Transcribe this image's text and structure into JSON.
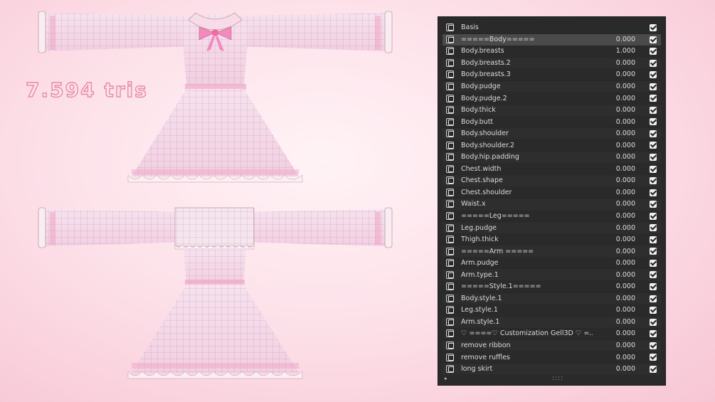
{
  "overlay_label": "7.594 tris",
  "shape_keys": [
    {
      "name": "Basis",
      "value": "",
      "enabled": true
    },
    {
      "name": "=====Body=====",
      "value": "0.000",
      "enabled": true
    },
    {
      "name": "Body.breasts",
      "value": "1.000",
      "enabled": true
    },
    {
      "name": "Body.breasts.2",
      "value": "0.000",
      "enabled": true
    },
    {
      "name": "Body.breasts.3",
      "value": "0.000",
      "enabled": true
    },
    {
      "name": "Body.pudge",
      "value": "0.000",
      "enabled": true
    },
    {
      "name": "Body.pudge.2",
      "value": "0.000",
      "enabled": true
    },
    {
      "name": "Body.thick",
      "value": "0.000",
      "enabled": true
    },
    {
      "name": "Body.butt",
      "value": "0.000",
      "enabled": true
    },
    {
      "name": "Body.shoulder",
      "value": "0.000",
      "enabled": true
    },
    {
      "name": "Body.shoulder.2",
      "value": "0.000",
      "enabled": true
    },
    {
      "name": "Body.hip.padding",
      "value": "0.000",
      "enabled": true
    },
    {
      "name": "Chest.width",
      "value": "0.000",
      "enabled": true
    },
    {
      "name": "Chest.shape",
      "value": "0.000",
      "enabled": true
    },
    {
      "name": "Chest.shoulder",
      "value": "0.000",
      "enabled": true
    },
    {
      "name": "Waist.x",
      "value": "0.000",
      "enabled": true
    },
    {
      "name": "=====Leg=====",
      "value": "0.000",
      "enabled": true
    },
    {
      "name": "Leg.pudge",
      "value": "0.000",
      "enabled": true
    },
    {
      "name": "Thigh.thick",
      "value": "0.000",
      "enabled": true
    },
    {
      "name": "=====Arm =====",
      "value": "0.000",
      "enabled": true
    },
    {
      "name": "Arm.pudge",
      "value": "0.000",
      "enabled": true
    },
    {
      "name": "Arm.type.1",
      "value": "0.000",
      "enabled": true
    },
    {
      "name": "=====Style.1=====",
      "value": "0.000",
      "enabled": true
    },
    {
      "name": "Body.style.1",
      "value": "0.000",
      "enabled": true
    },
    {
      "name": "Leg.style.1",
      "value": "0.000",
      "enabled": true
    },
    {
      "name": "Arm.style.1",
      "value": "0.000",
      "enabled": true
    },
    {
      "name": "♡ ====♡ Customization Gell3D ♡ =...",
      "value": "0.000",
      "enabled": true
    },
    {
      "name": "remove ribbon",
      "value": "0.000",
      "enabled": true
    },
    {
      "name": "remove ruffles",
      "value": "0.000",
      "enabled": true
    },
    {
      "name": "long skirt",
      "value": "0.000",
      "enabled": true
    }
  ],
  "footer": {
    "expand_icon": "▸",
    "drag_handle": "::::"
  },
  "colors": {
    "dress": "#f5d5e6",
    "stripe": "#f0a8c6",
    "bow": "#f28ac0",
    "wire": "#7a5a6a"
  }
}
